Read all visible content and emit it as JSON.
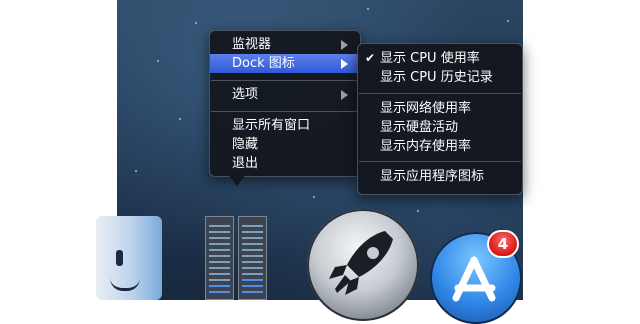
{
  "context_menu": {
    "items": [
      {
        "label": "监视器",
        "has_submenu": true
      },
      {
        "label": "Dock 图标",
        "has_submenu": true,
        "highlighted": true
      },
      {
        "label": "选项",
        "has_submenu": true
      },
      {
        "label": "显示所有窗口"
      },
      {
        "label": "隐藏"
      },
      {
        "label": "退出"
      }
    ]
  },
  "submenu": {
    "items": [
      {
        "label": "显示 CPU 使用率",
        "checked": true,
        "check_mark": "✔"
      },
      {
        "label": "显示 CPU 历史记录"
      },
      {
        "label": "显示网络使用率"
      },
      {
        "label": "显示硬盘活动"
      },
      {
        "label": "显示内存使用率"
      },
      {
        "label": "显示应用程序图标"
      }
    ]
  },
  "dock": {
    "icons": [
      "finder-icon",
      "activity-monitor-icon",
      "launchpad-icon",
      "app-store-icon"
    ],
    "app_store_badge": "4"
  },
  "colors": {
    "highlight": "#2f5ad8",
    "menu_bg": "#12161c",
    "badge": "#d81818"
  }
}
